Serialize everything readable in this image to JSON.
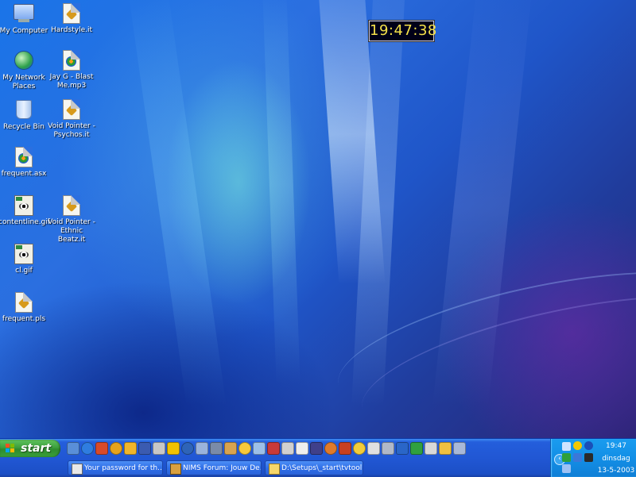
{
  "desktop": {
    "icons": [
      {
        "label": "My Computer",
        "icon": "my-computer-icon"
      },
      {
        "label": "My Network Places",
        "icon": "network-places-icon"
      },
      {
        "label": "Recycle Bin",
        "icon": "recycle-bin-icon"
      },
      {
        "label": "frequent.asx",
        "icon": "media-file-icon"
      },
      {
        "label": "contentline.gif",
        "icon": "gif-image-icon"
      },
      {
        "label": "cl.gif",
        "icon": "gif-image-icon"
      },
      {
        "label": "frequent.pls",
        "icon": "playlist-file-icon"
      },
      {
        "label": "Hardstyle.it",
        "icon": "it-file-icon"
      },
      {
        "label": "Jay G - Blast Me.mp3",
        "icon": "media-file-icon"
      },
      {
        "label": "Void Pointer - Psychos.it",
        "icon": "it-file-icon"
      },
      {
        "label": "Void Pointer - Ethnic Beatz.it",
        "icon": "it-file-icon"
      }
    ]
  },
  "clock_widget": {
    "time": "19:47:38"
  },
  "taskbar": {
    "start_label": "start",
    "tasks": [
      {
        "label": "Your password for th...",
        "icon": "password-app-icon"
      },
      {
        "label": "NIMS Forum: Jouw De...",
        "icon": "browser-window-icon"
      },
      {
        "label": "D:\\Setups\\_start\\tvtool",
        "icon": "folder-icon"
      }
    ],
    "tray": {
      "time": "19:47",
      "day": "dinsdag",
      "date": "13-5-2003",
      "expand_glyph": "‹"
    }
  },
  "colors": {
    "clock_digits": "#f6e24a",
    "start_green": "#3c9e3c",
    "taskbar_blue": "#245edc",
    "tray_blue": "#138fe6"
  }
}
